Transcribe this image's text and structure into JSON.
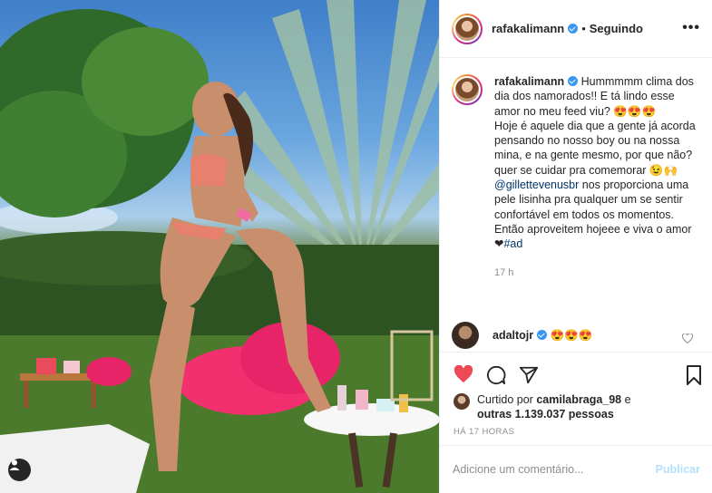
{
  "header": {
    "username": "rafakalimann",
    "separator": "•",
    "follow_status": "Seguindo",
    "more": "•••"
  },
  "caption": {
    "username": "rafakalimann",
    "line1": "Hummmmm clima dos dia dos namorados!! E tá lindo esse amor no meu feed viu? 😍😍😍",
    "line2": "Hoje é aquele dia que a gente já acorda pensando no nosso boy ou na nossa mina, e na gente mesmo, por que não? quer se cuidar pra comemorar 😉🙌",
    "mention": "@gillettevenusbr",
    "line3": "nos proporciona uma pele lisinha pra qualquer um se sentir confortável em todos os momentos.",
    "line4": "Então aproveitem hojeee e viva o amor ❤",
    "hashtag": "#ad",
    "time": "17 h"
  },
  "comment": {
    "username": "adaltojr",
    "text": "😍😍😍"
  },
  "likes": {
    "prefix": "Curtido por",
    "user": "camilabraga_98",
    "conj": "e",
    "others": "outras 1.139.037 pessoas"
  },
  "post_time": "HÁ 17 HORAS",
  "add_comment": {
    "placeholder": "Adicione um comentário...",
    "publish": "Publicar"
  },
  "colors": {
    "like_red": "#ed4956",
    "link_blue": "#003569",
    "verified_blue": "#3897f0",
    "publish_disabled": "#b2dffc"
  }
}
